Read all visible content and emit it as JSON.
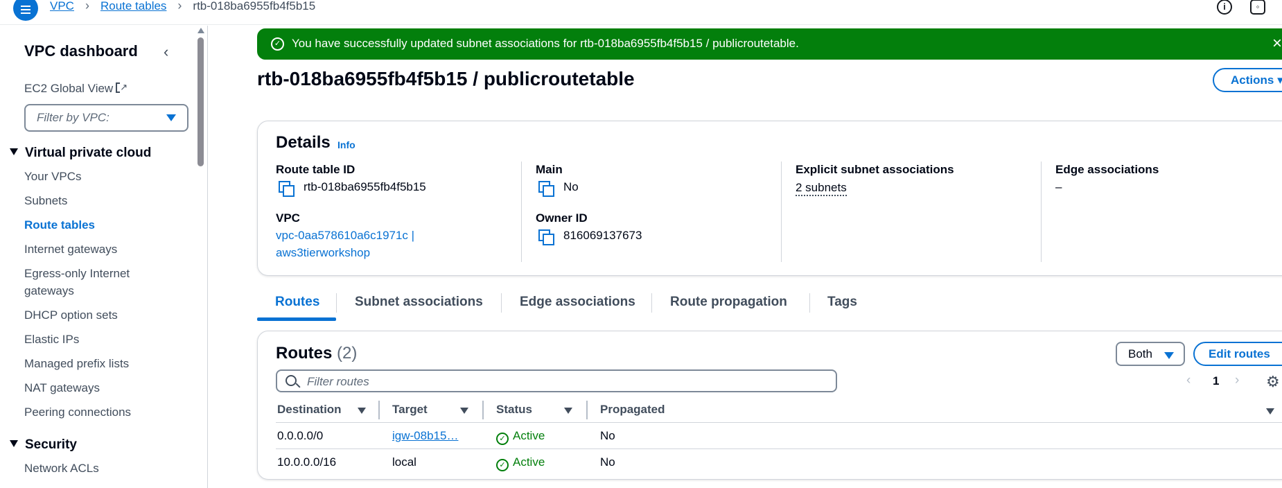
{
  "header": {
    "breadcrumbs": [
      "VPC",
      "Route tables",
      "rtb-018ba6955fb4f5b15"
    ]
  },
  "sidebar": {
    "title": "VPC dashboard",
    "ec2_global_view": "EC2 Global View",
    "filter_placeholder": "Filter by VPC:",
    "section_vpc": "Virtual private cloud",
    "items": [
      {
        "label": "Your VPCs"
      },
      {
        "label": "Subnets"
      },
      {
        "label": "Route tables",
        "active": true
      },
      {
        "label": "Internet gateways"
      },
      {
        "label": "Egress-only Internet gateways"
      },
      {
        "label": "DHCP option sets"
      },
      {
        "label": "Elastic IPs"
      },
      {
        "label": "Managed prefix lists"
      },
      {
        "label": "NAT gateways"
      },
      {
        "label": "Peering connections"
      }
    ],
    "section_security": "Security",
    "security_items": [
      {
        "label": "Network ACLs"
      }
    ]
  },
  "flash": {
    "message": "You have successfully updated subnet associations for rtb-018ba6955fb4f5b15 / publicroutetable."
  },
  "page": {
    "title": "rtb-018ba6955fb4f5b15 / publicroutetable",
    "actions_label": "Actions"
  },
  "details": {
    "heading": "Details",
    "info": "Info",
    "route_table_id_label": "Route table ID",
    "route_table_id": "rtb-018ba6955fb4f5b15",
    "vpc_label": "VPC",
    "vpc_line1": "vpc-0aa578610a6c1971c |",
    "vpc_line2": "aws3tierworkshop",
    "main_label": "Main",
    "main_value": "No",
    "owner_label": "Owner ID",
    "owner_value": "816069137673",
    "explicit_label": "Explicit subnet associations",
    "explicit_value": "2 subnets",
    "edge_label": "Edge associations",
    "edge_value": "–"
  },
  "tabs": [
    "Routes",
    "Subnet associations",
    "Edge associations",
    "Route propagation",
    "Tags"
  ],
  "routes": {
    "heading": "Routes",
    "count": "(2)",
    "both_label": "Both",
    "edit_label": "Edit routes",
    "filter_placeholder": "Filter routes",
    "page": "1",
    "columns": [
      "Destination",
      "Target",
      "Status",
      "Propagated"
    ],
    "rows": [
      {
        "destination": "0.0.0.0/0",
        "target": "igw-08b15…",
        "status": "Active",
        "propagated": "No"
      },
      {
        "destination": "10.0.0.0/16",
        "target": "local",
        "status": "Active",
        "propagated": "No"
      }
    ]
  },
  "colors": {
    "accent": "#0972d3",
    "success": "#037f0c"
  }
}
